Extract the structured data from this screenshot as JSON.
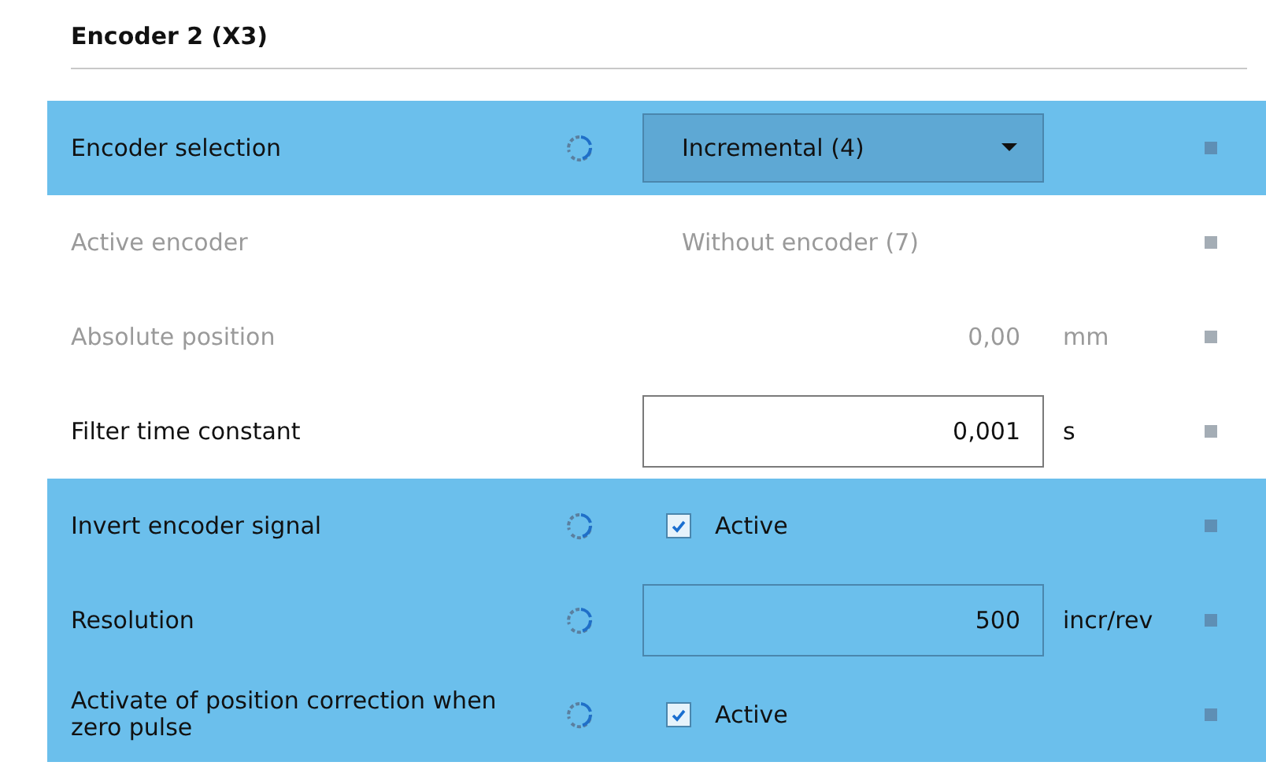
{
  "section": {
    "title": "Encoder 2 (X3)"
  },
  "rows": [
    {
      "label": "Encoder selection",
      "kind": "dropdown",
      "value": "Incremental (4)",
      "highlighted": true,
      "disabled": false,
      "sync": true
    },
    {
      "label": "Active encoder",
      "kind": "text",
      "value": "Without encoder (7)",
      "highlighted": false,
      "disabled": true,
      "sync": false
    },
    {
      "label": "Absolute position",
      "kind": "readout",
      "value": "0,00",
      "unit": "mm",
      "highlighted": false,
      "disabled": true,
      "sync": false
    },
    {
      "label": "Filter time constant",
      "kind": "input",
      "value": "0,001",
      "unit": "s",
      "highlighted": false,
      "disabled": false,
      "sync": false
    },
    {
      "label": "Invert encoder signal",
      "kind": "checkbox",
      "value": "Active",
      "checked": true,
      "highlighted": true,
      "disabled": false,
      "sync": true
    },
    {
      "label": "Resolution",
      "kind": "input",
      "value": "500",
      "unit": "incr/rev",
      "highlighted": true,
      "disabled": false,
      "sync": true
    },
    {
      "label": "Activate of position correction when zero pulse",
      "kind": "checkbox",
      "value": "Active",
      "checked": true,
      "highlighted": true,
      "disabled": false,
      "sync": true
    }
  ]
}
